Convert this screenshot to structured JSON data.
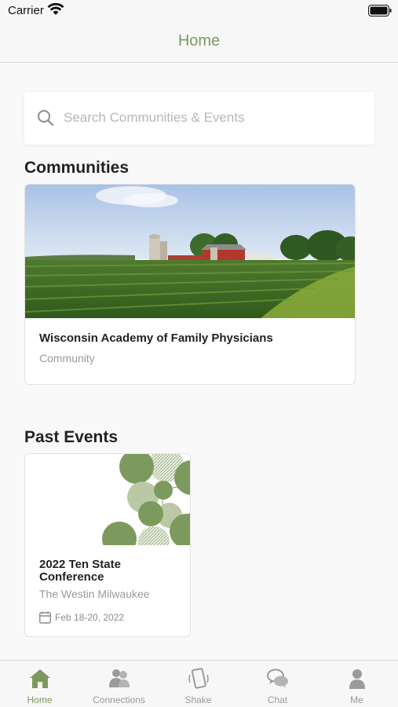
{
  "status_bar": {
    "carrier": "Carrier"
  },
  "nav": {
    "title": "Home"
  },
  "search": {
    "placeholder": "Search Communities & Events"
  },
  "communities": {
    "title": "Communities",
    "items": [
      {
        "name": "Wisconsin Academy of Family Physicians",
        "type": "Community"
      }
    ]
  },
  "past_events": {
    "title": "Past Events",
    "items": [
      {
        "title": "2022 Ten State Conference",
        "venue": "The Westin Milwaukee",
        "date": "Feb 18-20, 2022"
      }
    ]
  },
  "tabs": [
    {
      "label": "Home",
      "icon": "home-icon",
      "active": true
    },
    {
      "label": "Connections",
      "icon": "connections-icon",
      "active": false
    },
    {
      "label": "Shake",
      "icon": "shake-icon",
      "active": false
    },
    {
      "label": "Chat",
      "icon": "chat-icon",
      "active": false
    },
    {
      "label": "Me",
      "icon": "me-icon",
      "active": false
    }
  ],
  "colors": {
    "accent": "#7d9a5e",
    "inactive": "#9a9a9a"
  }
}
